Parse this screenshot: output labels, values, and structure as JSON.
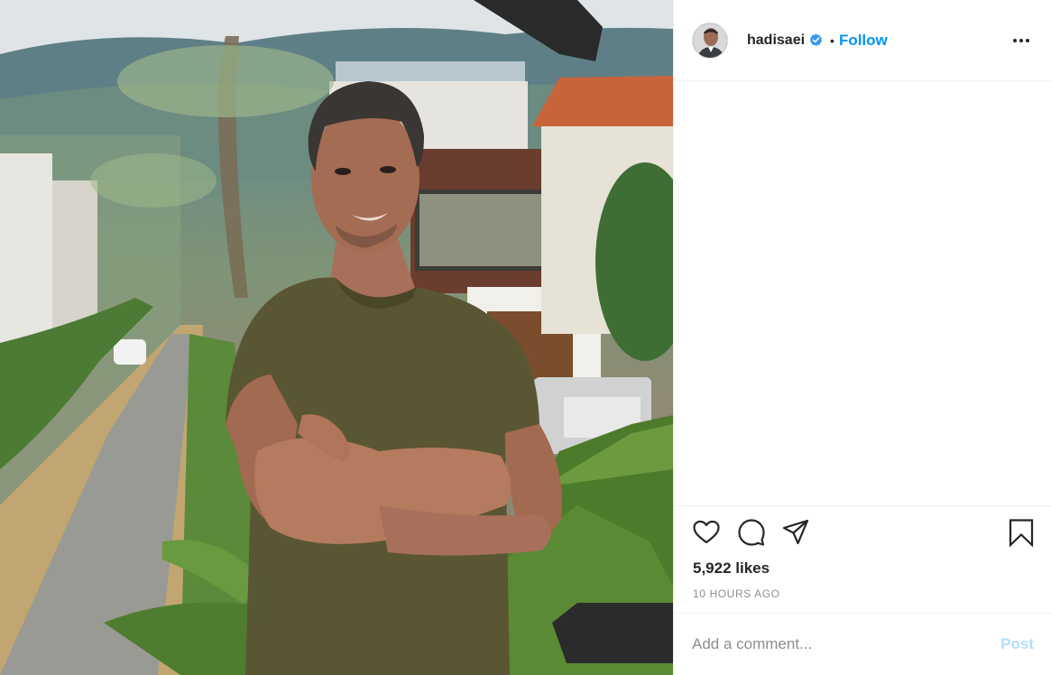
{
  "colors": {
    "accent": "#0095f6",
    "post_disabled": "#b2dffc",
    "muted": "#8e8e8e",
    "text": "#262626"
  },
  "header": {
    "username": "hadisaei",
    "verified": true,
    "separator": "•",
    "follow_label": "Follow",
    "more_icon": "more-options-icon"
  },
  "photo": {
    "subject": "man-arms-crossed"
  },
  "actions": {
    "like_icon": "heart-icon",
    "comment_icon": "comment-icon",
    "share_icon": "paper-plane-icon",
    "save_icon": "bookmark-icon"
  },
  "stats": {
    "likes": "5,922 likes",
    "timestamp": "10 HOURS AGO"
  },
  "comment": {
    "placeholder": "Add a comment...",
    "post_label": "Post"
  }
}
